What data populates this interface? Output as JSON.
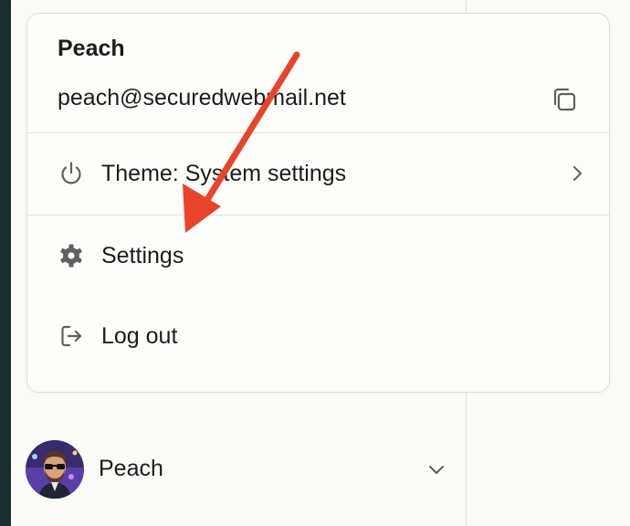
{
  "menu": {
    "user_name": "Peach",
    "user_email": "peach@securedwebmail.net",
    "items": [
      {
        "label": "Theme: System settings",
        "icon": "power-icon",
        "has_submenu": true
      },
      {
        "label": "Settings",
        "icon": "gear-icon"
      },
      {
        "label": "Log out",
        "icon": "logout-icon"
      }
    ]
  },
  "profile": {
    "name": "Peach",
    "icon": "chevron-down-icon"
  },
  "annotation": {
    "arrow_color": "#e8432b"
  },
  "colors": {
    "background": "#fbfbf8",
    "left_strip": "#1a2e2e",
    "border": "#e0e0da",
    "icon": "#5f5f5f"
  }
}
